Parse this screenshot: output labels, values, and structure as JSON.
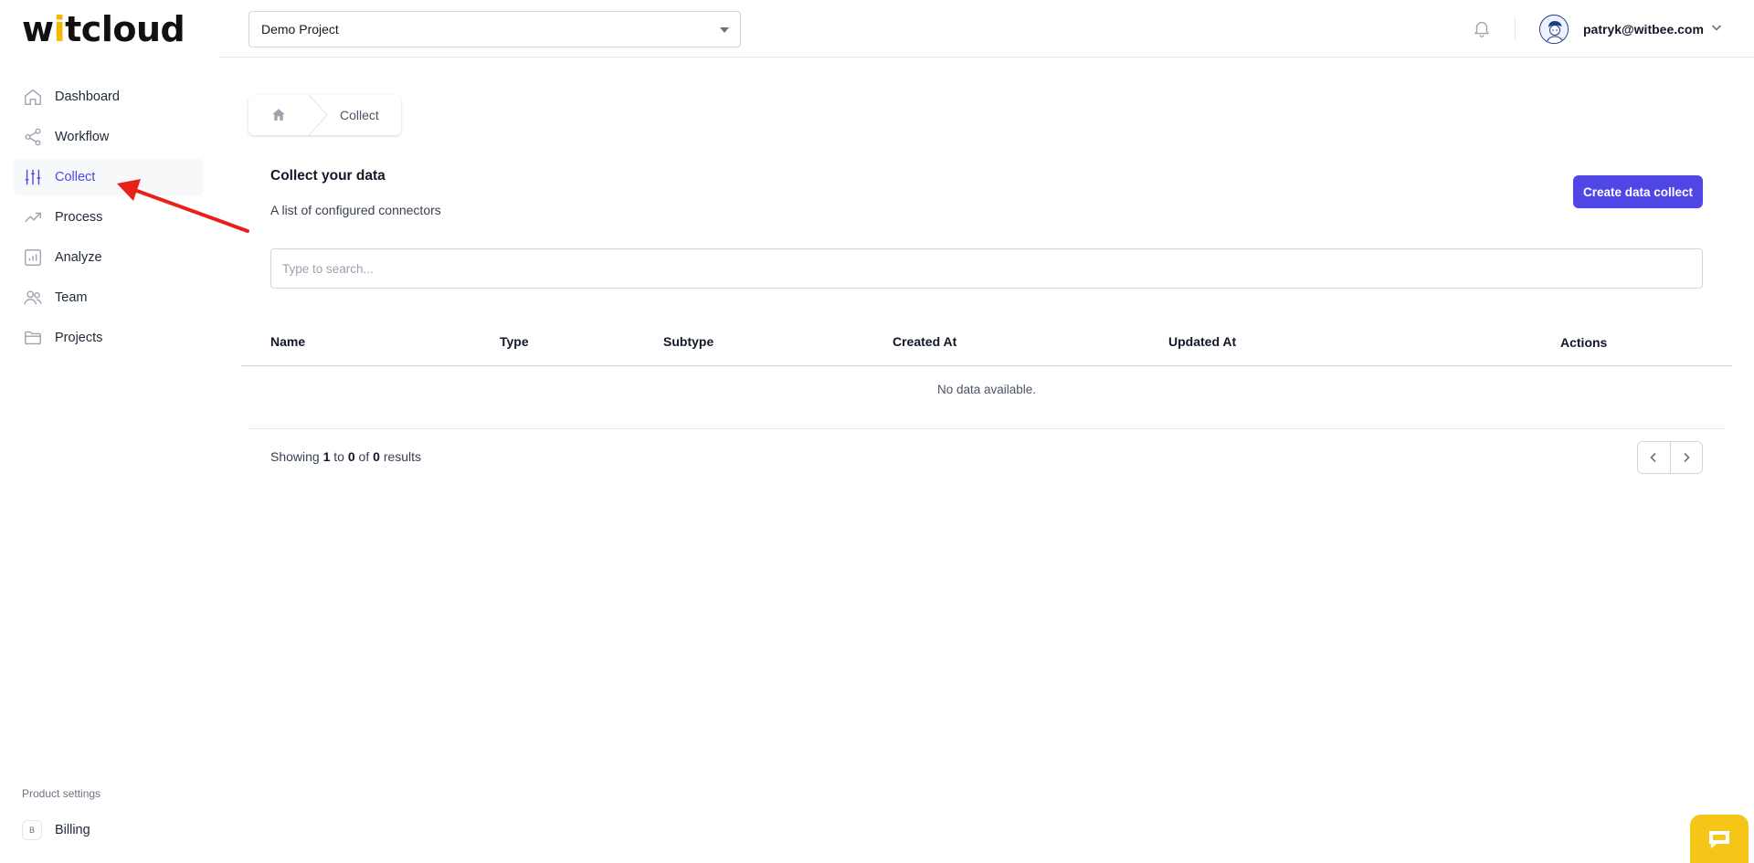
{
  "app": {
    "logo_left": "w",
    "logo_dot": "i",
    "logo_right": "tcloud"
  },
  "sidebar": {
    "items": [
      {
        "label": "Dashboard",
        "icon": "home-icon"
      },
      {
        "label": "Workflow",
        "icon": "share-icon"
      },
      {
        "label": "Collect",
        "icon": "sliders-icon",
        "active": true
      },
      {
        "label": "Process",
        "icon": "trending-up-icon"
      },
      {
        "label": "Analyze",
        "icon": "bar-chart-icon"
      },
      {
        "label": "Team",
        "icon": "users-icon"
      },
      {
        "label": "Projects",
        "icon": "folder-icon"
      }
    ],
    "product_settings_title": "Product settings",
    "billing_badge": "B",
    "billing_label": "Billing"
  },
  "topbar": {
    "project_value": "Demo Project",
    "user_email": "patryk@witbee.com"
  },
  "breadcrumb": {
    "current": "Collect"
  },
  "page": {
    "title": "Collect your data",
    "subtitle": "A list of configured connectors",
    "create_button": "Create data collect",
    "search_placeholder": "Type to search..."
  },
  "table": {
    "columns": [
      "Name",
      "Type",
      "Subtype",
      "Created At",
      "Updated At",
      "Actions"
    ],
    "empty_text": "No data available."
  },
  "pagination": {
    "prefix": "Showing",
    "from": "1",
    "to_word": "to",
    "to": "0",
    "of_word": "of",
    "total": "0",
    "suffix": "results"
  },
  "colors": {
    "accent": "#4f46e5",
    "logo_dot": "#f5b800",
    "chat_widget": "#f5c518",
    "annotation_arrow": "#e8201a"
  }
}
